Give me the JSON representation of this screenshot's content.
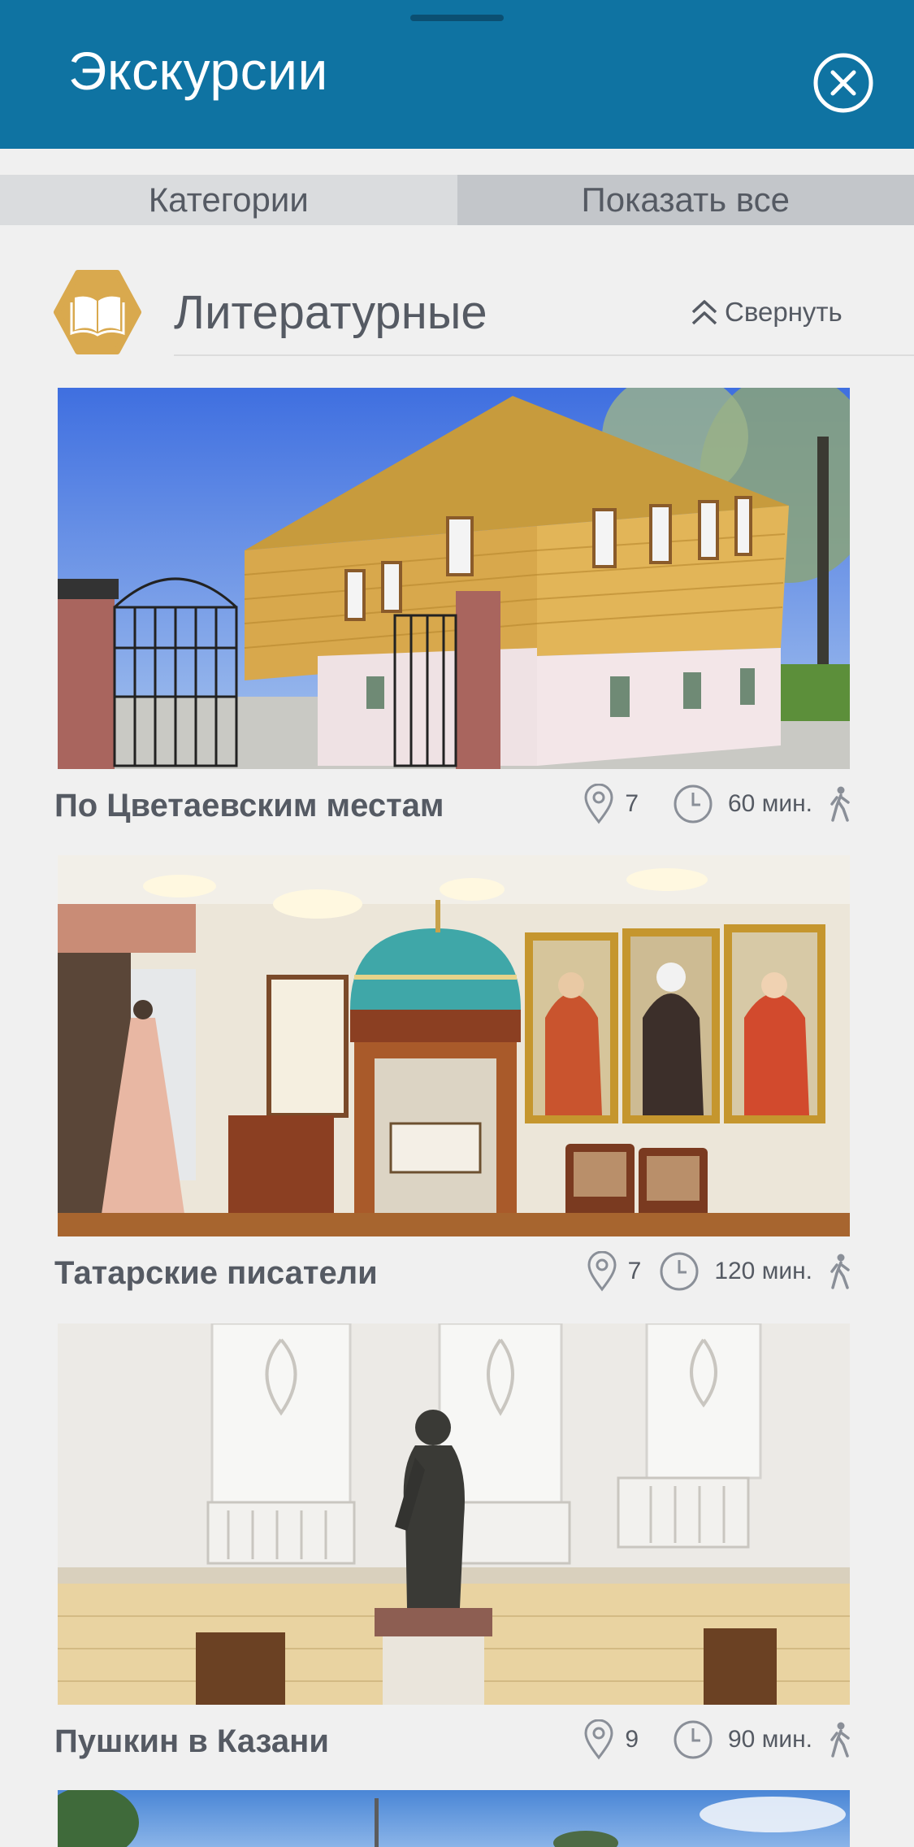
{
  "header": {
    "title": "Экскурсии"
  },
  "tabs": [
    {
      "label": "Категории"
    },
    {
      "label": "Показать все"
    }
  ],
  "section": {
    "title": "Литературные",
    "collapse_label": "Свернуть",
    "icon": "book-icon"
  },
  "excursions": [
    {
      "title": "По Цветаевским местам",
      "points": "7",
      "duration": "60 мин."
    },
    {
      "title": "Татарские писатели",
      "points": "7",
      "duration": "120 мин."
    },
    {
      "title": "Пушкин в Казани",
      "points": "9",
      "duration": "90 мин."
    }
  ],
  "colors": {
    "header_bg": "#0f73a2",
    "accent_gold": "#d9a94e",
    "text": "#555a63"
  }
}
